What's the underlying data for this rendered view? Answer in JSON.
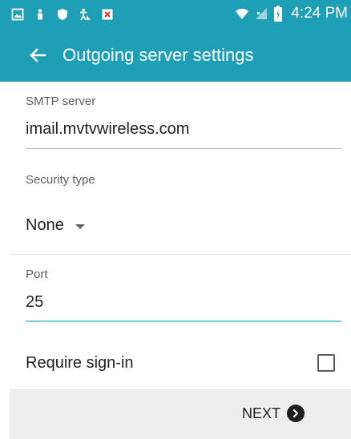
{
  "status_bar": {
    "time": "4:24 PM",
    "left_icons": [
      "gallery-icon",
      "person-icon",
      "shield-icon",
      "accessibility-icon",
      "close-box-icon"
    ],
    "right_icons": [
      "wifi-icon",
      "signal-icon",
      "battery-charging-icon"
    ]
  },
  "app_bar": {
    "title": "Outgoing server settings",
    "back_icon": "arrow-left-icon"
  },
  "smtp": {
    "label": "SMTP server",
    "value": "imail.mvtvwireless.com"
  },
  "security": {
    "label": "Security type",
    "value": "None"
  },
  "port": {
    "label": "Port",
    "value": "25"
  },
  "signin": {
    "label": "Require sign-in",
    "checked": false
  },
  "bottom_bar": {
    "next_label": "NEXT",
    "next_icon": "chevron-right-circle-icon"
  },
  "colors": {
    "primary": "#1e9fb6",
    "active_underline": "#7fc9da",
    "bottom_bar": "#eeeeee"
  }
}
